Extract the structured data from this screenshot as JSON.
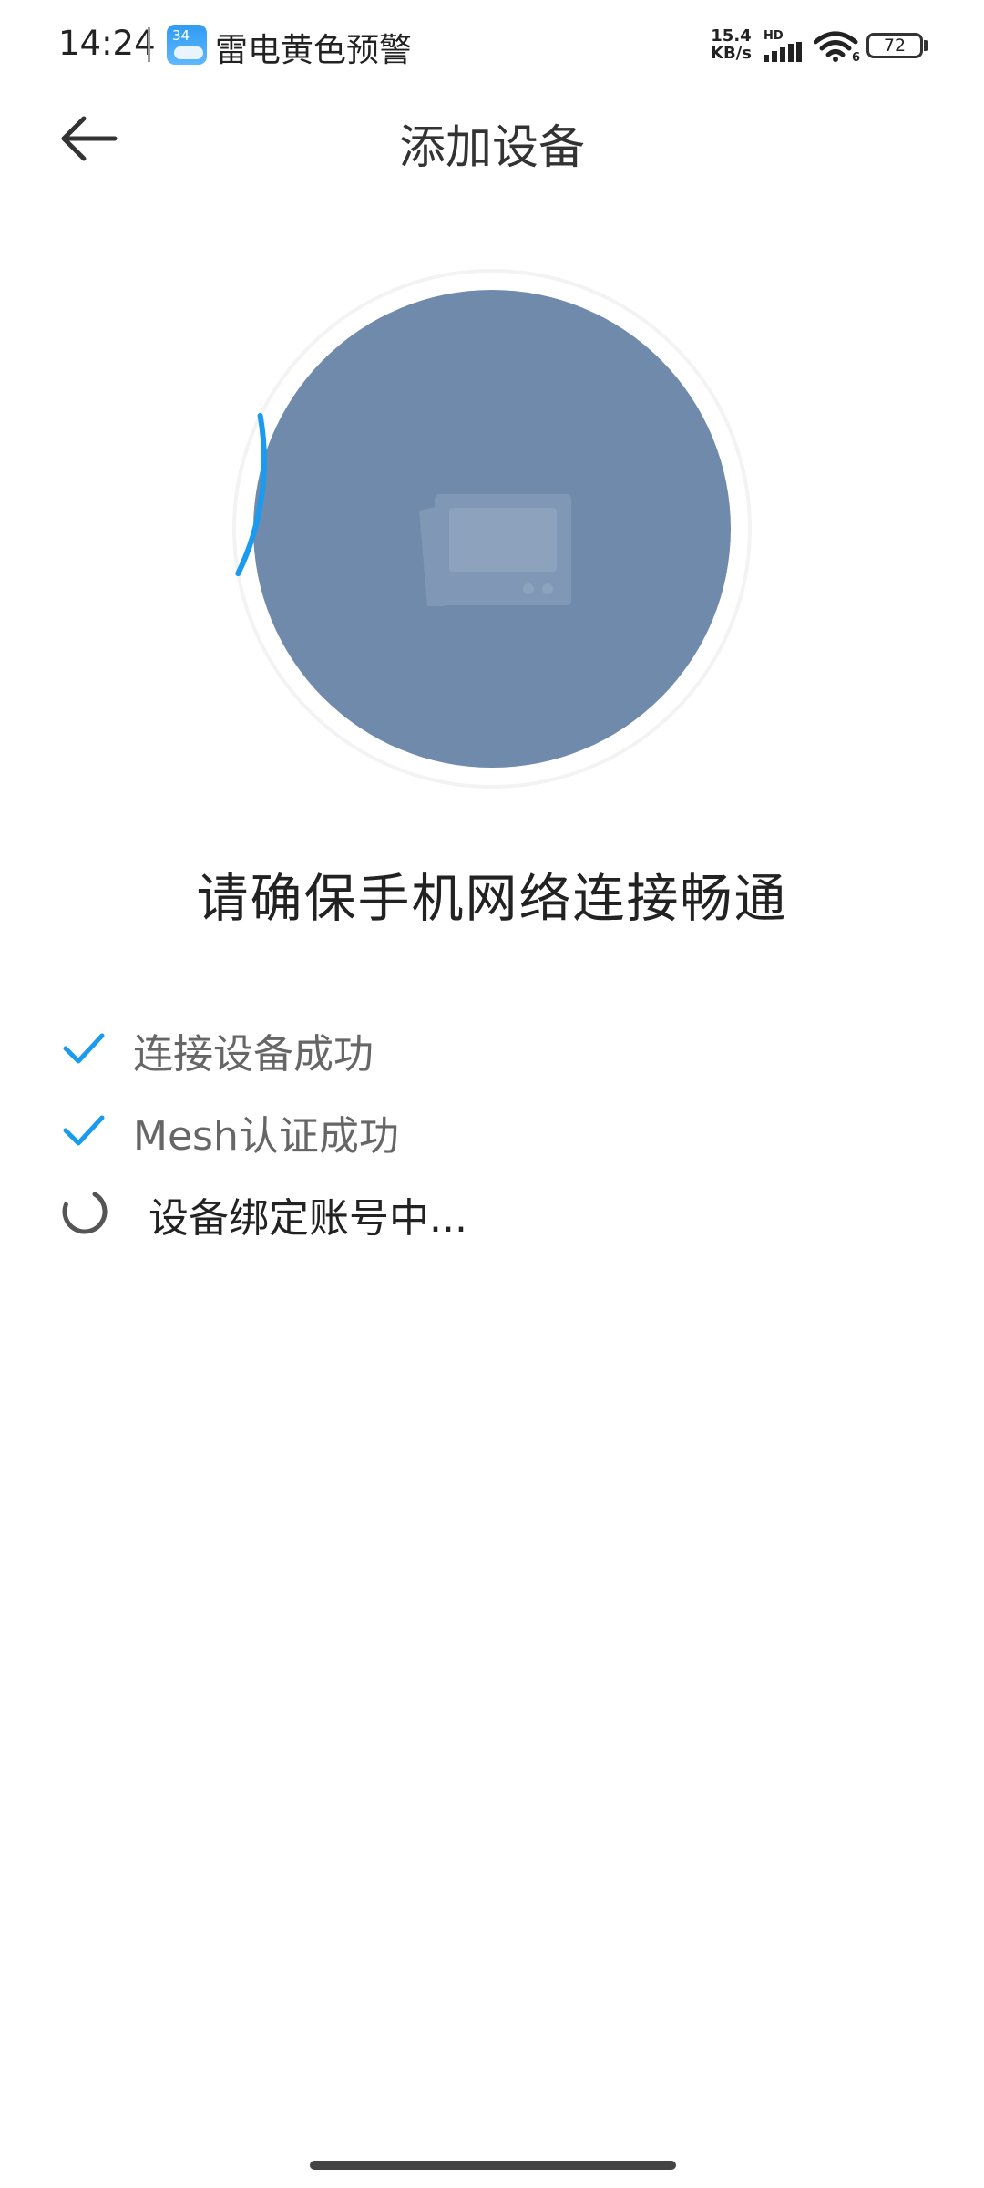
{
  "status_bar": {
    "time": "14:24",
    "notification_badge": "34",
    "notification_text": "雷电黄色预警",
    "net_speed_value": "15.4",
    "net_speed_unit": "KB/s",
    "network_label": "HD",
    "wifi_label": "6",
    "battery": "72"
  },
  "header": {
    "title": "添加设备"
  },
  "main": {
    "progress_fraction": 0.1,
    "heading": "请确保手机网络连接畅通",
    "steps": [
      {
        "label": "连接设备成功",
        "status": "done"
      },
      {
        "label": "Mesh认证成功",
        "status": "done"
      },
      {
        "label": "设备绑定账号中...",
        "status": "pending"
      }
    ]
  },
  "colors": {
    "accent": "#1a9bf0",
    "circle": "#6f8aab",
    "spinner": "#555555"
  },
  "icons": [
    "back-arrow-icon",
    "weather-icon",
    "signal-icon",
    "wifi-icon",
    "battery-icon",
    "device-icon",
    "checkmark-icon",
    "spinner-icon"
  ]
}
